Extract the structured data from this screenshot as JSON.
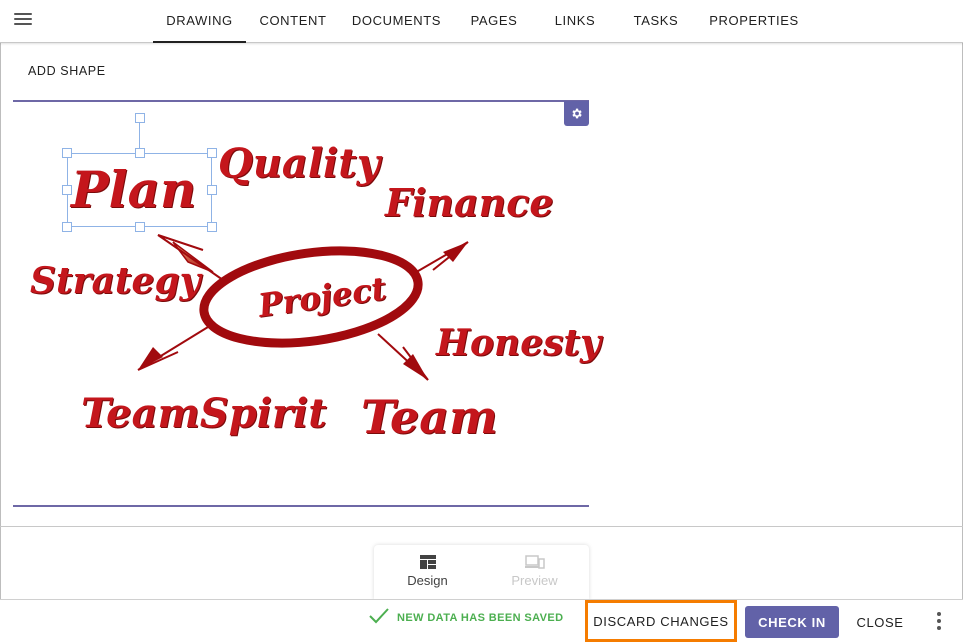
{
  "topbar": {
    "menu_icon": "hamburger-menu-icon",
    "tabs": [
      {
        "label": "DRAWING",
        "active": true
      },
      {
        "label": "CONTENT",
        "active": false
      },
      {
        "label": "DOCUMENTS",
        "active": false
      },
      {
        "label": "PAGES",
        "active": false
      },
      {
        "label": "LINKS",
        "active": false
      },
      {
        "label": "TASKS",
        "active": false
      },
      {
        "label": "PROPERTIES",
        "active": false
      }
    ]
  },
  "drawing": {
    "add_shape_label": "ADD SHAPE",
    "settings_icon": "gear-icon",
    "words": {
      "plan": "Plan",
      "quality": "Quality",
      "finance": "Finance",
      "strategy": "Strategy",
      "project": "Project",
      "honesty": "Honesty",
      "teamspirit": "TeamSpirit",
      "team": "Team"
    }
  },
  "mode_switch": {
    "design_label": "Design",
    "preview_label": "Preview"
  },
  "bottombar": {
    "saved_text": "NEW DATA HAS BEEN SAVED",
    "discard_label": "DISCARD CHANGES",
    "checkin_label": "CHECK IN",
    "close_label": "CLOSE",
    "more_icon": "more-vertical-icon"
  },
  "colors": {
    "accent": "#6262a8",
    "highlight": "#f57c00",
    "success": "#4caf50",
    "word_red": "#c4161c"
  }
}
